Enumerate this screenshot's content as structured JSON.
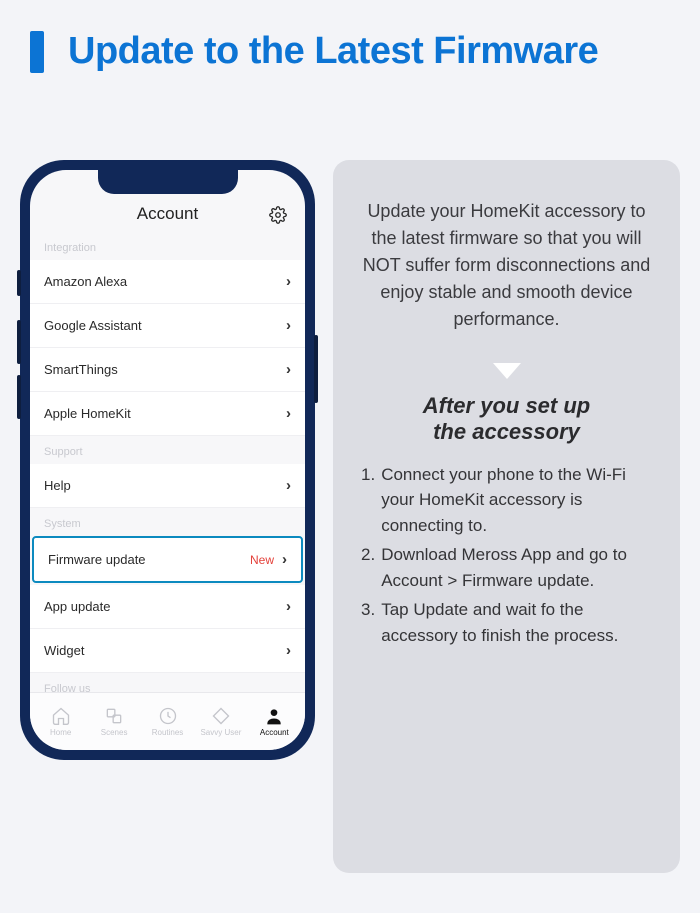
{
  "title": "Update to the Latest Firmware",
  "phone": {
    "header_title": "Account",
    "sections": {
      "integration": {
        "label": "Integration",
        "items": [
          "Amazon Alexa",
          "Google Assistant",
          "SmartThings",
          "Apple HomeKit"
        ]
      },
      "support": {
        "label": "Support",
        "items": [
          "Help"
        ]
      },
      "system": {
        "label": "System",
        "items": [
          {
            "label": "Firmware update",
            "badge": "New",
            "highlight": true
          },
          {
            "label": "App update"
          },
          {
            "label": "Widget"
          }
        ]
      },
      "follow": {
        "label": "Follow us"
      }
    },
    "tabs": [
      "Home",
      "Scenes",
      "Routines",
      "Savvy User",
      "Account"
    ],
    "active_tab": 4
  },
  "info": {
    "intro": "Update your HomeKit accessory to the latest firmware so that you will NOT suffer form disconnections and enjoy stable and smooth device performance.",
    "subtitle_l1": "After you set up",
    "subtitle_l2": "the accessory",
    "steps": [
      "Connect your phone to the Wi-Fi your HomeKit accessory is connecting to.",
      "Download Meross App and go to Account > Firmware update.",
      "Tap Update and wait fo the accessory to finish the process."
    ]
  }
}
